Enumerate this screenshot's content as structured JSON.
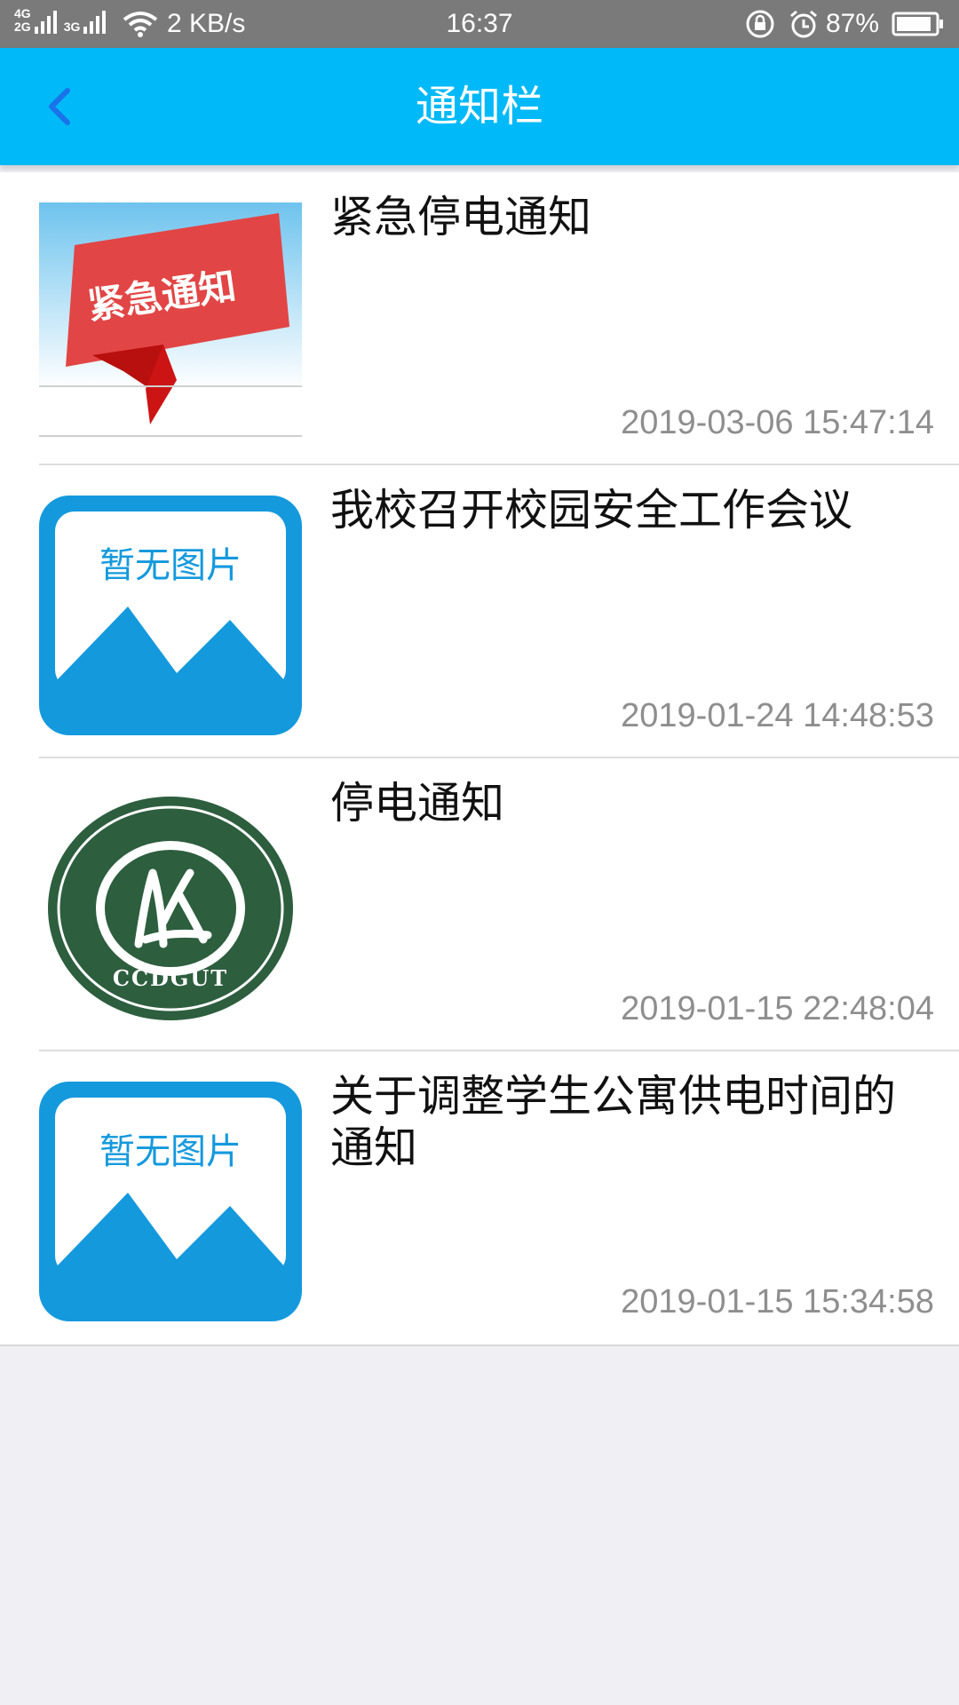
{
  "status_bar": {
    "net_type_top": "4G",
    "net_type_bottom": "2G",
    "net_type_3g": "3G",
    "speed": "2 KB/s",
    "time": "16:37",
    "battery": "87%"
  },
  "header": {
    "title": "通知栏",
    "back_icon": "chevron-left-icon",
    "back_color": "#1a73e8",
    "bg_color": "#00b9f8"
  },
  "notices": [
    {
      "title": "紧急停电通知",
      "time": "2019-03-06 15:47:14",
      "thumbnail": "urgent-notice-banner",
      "banner_text": "紧急通知"
    },
    {
      "title": "我校召开校园安全工作会议",
      "time": "2019-01-24 14:48:53",
      "thumbnail": "no-image-placeholder",
      "placeholder_text": "暂无图片"
    },
    {
      "title": "停电通知",
      "time": "2019-01-15 22:48:04",
      "thumbnail": "school-seal-logo",
      "logo_text": "CCDGUT"
    },
    {
      "title": "关于调整学生公寓供电时间的通知",
      "time": "2019-01-15 15:34:58",
      "thumbnail": "no-image-placeholder",
      "placeholder_text": "暂无图片"
    }
  ]
}
